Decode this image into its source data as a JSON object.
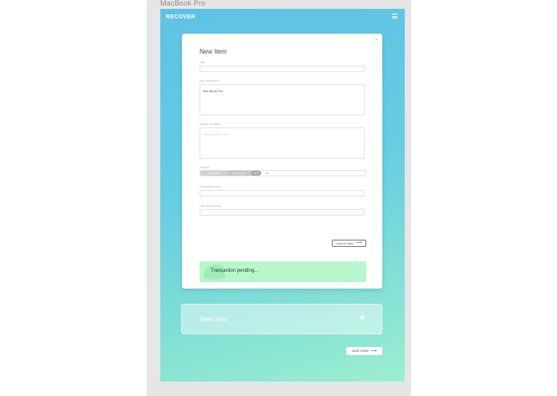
{
  "artboard": {
    "label": "MacBook Pro"
  },
  "header": {
    "brand": "RECOVER"
  },
  "modal": {
    "title": "New Item",
    "close": "×",
    "fields": {
      "title_label": "Title",
      "title_value": "",
      "description_label": "Item description",
      "description_value": "Mac Book Pro",
      "details_label": "Unique identifiers",
      "details_placeholder": "Serial number, etc",
      "reward_label": "Reward",
      "reward_options": [
        "Lorem ipsum",
        "Lorem ipsum",
        "ETH"
      ],
      "reward_value": "10",
      "field4_label": "Transaction hash",
      "field4_value": "",
      "field5_label": "Date of purchase",
      "field5_value": ""
    },
    "save_label": "SAVE MY ITEM",
    "arrow": "⟶",
    "transaction_status": "Transaction pending..."
  },
  "new_item": {
    "title": "New Item",
    "plus": "+"
  },
  "footer": {
    "save_items_label": "SAVE ITEMS",
    "arrow": "⟶"
  },
  "colors": {
    "gradient_top": "#5ec2e6",
    "gradient_bottom": "#9ceed0",
    "pending_bg": "#b8f7cc"
  }
}
